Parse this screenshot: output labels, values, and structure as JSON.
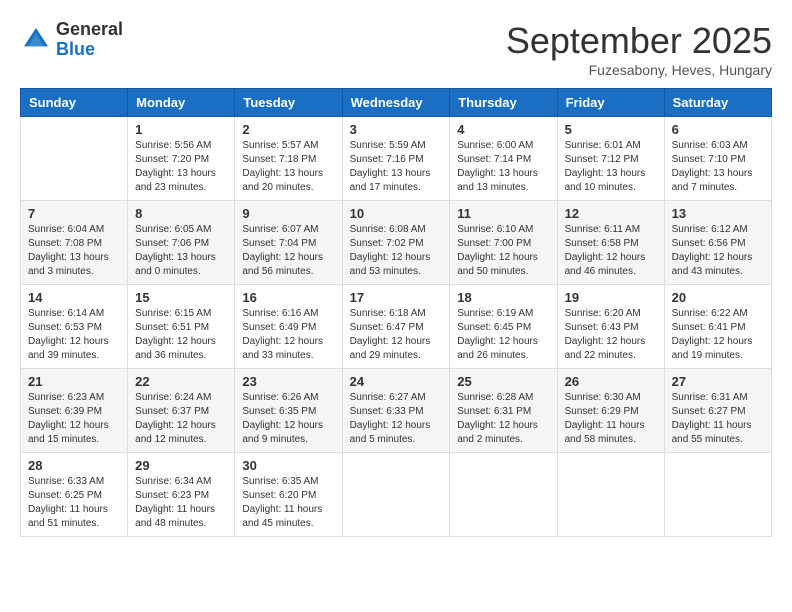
{
  "header": {
    "logo_general": "General",
    "logo_blue": "Blue",
    "month_title": "September 2025",
    "subtitle": "Fuzesabony, Heves, Hungary"
  },
  "weekdays": [
    "Sunday",
    "Monday",
    "Tuesday",
    "Wednesday",
    "Thursday",
    "Friday",
    "Saturday"
  ],
  "weeks": [
    [
      {
        "day": "",
        "sunrise": "",
        "sunset": "",
        "daylight": ""
      },
      {
        "day": "1",
        "sunrise": "Sunrise: 5:56 AM",
        "sunset": "Sunset: 7:20 PM",
        "daylight": "Daylight: 13 hours and 23 minutes."
      },
      {
        "day": "2",
        "sunrise": "Sunrise: 5:57 AM",
        "sunset": "Sunset: 7:18 PM",
        "daylight": "Daylight: 13 hours and 20 minutes."
      },
      {
        "day": "3",
        "sunrise": "Sunrise: 5:59 AM",
        "sunset": "Sunset: 7:16 PM",
        "daylight": "Daylight: 13 hours and 17 minutes."
      },
      {
        "day": "4",
        "sunrise": "Sunrise: 6:00 AM",
        "sunset": "Sunset: 7:14 PM",
        "daylight": "Daylight: 13 hours and 13 minutes."
      },
      {
        "day": "5",
        "sunrise": "Sunrise: 6:01 AM",
        "sunset": "Sunset: 7:12 PM",
        "daylight": "Daylight: 13 hours and 10 minutes."
      },
      {
        "day": "6",
        "sunrise": "Sunrise: 6:03 AM",
        "sunset": "Sunset: 7:10 PM",
        "daylight": "Daylight: 13 hours and 7 minutes."
      }
    ],
    [
      {
        "day": "7",
        "sunrise": "Sunrise: 6:04 AM",
        "sunset": "Sunset: 7:08 PM",
        "daylight": "Daylight: 13 hours and 3 minutes."
      },
      {
        "day": "8",
        "sunrise": "Sunrise: 6:05 AM",
        "sunset": "Sunset: 7:06 PM",
        "daylight": "Daylight: 13 hours and 0 minutes."
      },
      {
        "day": "9",
        "sunrise": "Sunrise: 6:07 AM",
        "sunset": "Sunset: 7:04 PM",
        "daylight": "Daylight: 12 hours and 56 minutes."
      },
      {
        "day": "10",
        "sunrise": "Sunrise: 6:08 AM",
        "sunset": "Sunset: 7:02 PM",
        "daylight": "Daylight: 12 hours and 53 minutes."
      },
      {
        "day": "11",
        "sunrise": "Sunrise: 6:10 AM",
        "sunset": "Sunset: 7:00 PM",
        "daylight": "Daylight: 12 hours and 50 minutes."
      },
      {
        "day": "12",
        "sunrise": "Sunrise: 6:11 AM",
        "sunset": "Sunset: 6:58 PM",
        "daylight": "Daylight: 12 hours and 46 minutes."
      },
      {
        "day": "13",
        "sunrise": "Sunrise: 6:12 AM",
        "sunset": "Sunset: 6:56 PM",
        "daylight": "Daylight: 12 hours and 43 minutes."
      }
    ],
    [
      {
        "day": "14",
        "sunrise": "Sunrise: 6:14 AM",
        "sunset": "Sunset: 6:53 PM",
        "daylight": "Daylight: 12 hours and 39 minutes."
      },
      {
        "day": "15",
        "sunrise": "Sunrise: 6:15 AM",
        "sunset": "Sunset: 6:51 PM",
        "daylight": "Daylight: 12 hours and 36 minutes."
      },
      {
        "day": "16",
        "sunrise": "Sunrise: 6:16 AM",
        "sunset": "Sunset: 6:49 PM",
        "daylight": "Daylight: 12 hours and 33 minutes."
      },
      {
        "day": "17",
        "sunrise": "Sunrise: 6:18 AM",
        "sunset": "Sunset: 6:47 PM",
        "daylight": "Daylight: 12 hours and 29 minutes."
      },
      {
        "day": "18",
        "sunrise": "Sunrise: 6:19 AM",
        "sunset": "Sunset: 6:45 PM",
        "daylight": "Daylight: 12 hours and 26 minutes."
      },
      {
        "day": "19",
        "sunrise": "Sunrise: 6:20 AM",
        "sunset": "Sunset: 6:43 PM",
        "daylight": "Daylight: 12 hours and 22 minutes."
      },
      {
        "day": "20",
        "sunrise": "Sunrise: 6:22 AM",
        "sunset": "Sunset: 6:41 PM",
        "daylight": "Daylight: 12 hours and 19 minutes."
      }
    ],
    [
      {
        "day": "21",
        "sunrise": "Sunrise: 6:23 AM",
        "sunset": "Sunset: 6:39 PM",
        "daylight": "Daylight: 12 hours and 15 minutes."
      },
      {
        "day": "22",
        "sunrise": "Sunrise: 6:24 AM",
        "sunset": "Sunset: 6:37 PM",
        "daylight": "Daylight: 12 hours and 12 minutes."
      },
      {
        "day": "23",
        "sunrise": "Sunrise: 6:26 AM",
        "sunset": "Sunset: 6:35 PM",
        "daylight": "Daylight: 12 hours and 9 minutes."
      },
      {
        "day": "24",
        "sunrise": "Sunrise: 6:27 AM",
        "sunset": "Sunset: 6:33 PM",
        "daylight": "Daylight: 12 hours and 5 minutes."
      },
      {
        "day": "25",
        "sunrise": "Sunrise: 6:28 AM",
        "sunset": "Sunset: 6:31 PM",
        "daylight": "Daylight: 12 hours and 2 minutes."
      },
      {
        "day": "26",
        "sunrise": "Sunrise: 6:30 AM",
        "sunset": "Sunset: 6:29 PM",
        "daylight": "Daylight: 11 hours and 58 minutes."
      },
      {
        "day": "27",
        "sunrise": "Sunrise: 6:31 AM",
        "sunset": "Sunset: 6:27 PM",
        "daylight": "Daylight: 11 hours and 55 minutes."
      }
    ],
    [
      {
        "day": "28",
        "sunrise": "Sunrise: 6:33 AM",
        "sunset": "Sunset: 6:25 PM",
        "daylight": "Daylight: 11 hours and 51 minutes."
      },
      {
        "day": "29",
        "sunrise": "Sunrise: 6:34 AM",
        "sunset": "Sunset: 6:23 PM",
        "daylight": "Daylight: 11 hours and 48 minutes."
      },
      {
        "day": "30",
        "sunrise": "Sunrise: 6:35 AM",
        "sunset": "Sunset: 6:20 PM",
        "daylight": "Daylight: 11 hours and 45 minutes."
      },
      {
        "day": "",
        "sunrise": "",
        "sunset": "",
        "daylight": ""
      },
      {
        "day": "",
        "sunrise": "",
        "sunset": "",
        "daylight": ""
      },
      {
        "day": "",
        "sunrise": "",
        "sunset": "",
        "daylight": ""
      },
      {
        "day": "",
        "sunrise": "",
        "sunset": "",
        "daylight": ""
      }
    ]
  ]
}
